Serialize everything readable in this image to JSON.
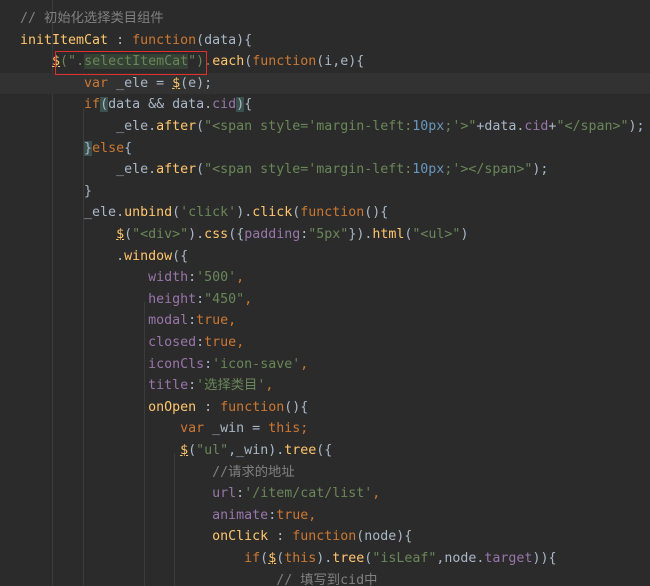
{
  "editor": {
    "language": "javascript",
    "lines": [
      {
        "segments": [
          {
            "t": "// 初始化选择类目组件",
            "c": "c"
          }
        ]
      },
      {
        "segments": [
          {
            "t": "initItemCat",
            "c": "f"
          },
          {
            "t": " : ",
            "c": "o"
          },
          {
            "t": "function",
            "c": "k"
          },
          {
            "t": "(data){",
            "c": "o"
          }
        ]
      },
      {
        "segments": [
          {
            "t": "    ",
            "c": "t"
          },
          {
            "t": "$",
            "c": "f",
            "u": true
          },
          {
            "t": "(\"",
            "c": "s"
          },
          {
            "t": ".",
            "c": "s"
          },
          {
            "t": "selectItemCat",
            "c": "s",
            "hl": "w"
          },
          {
            "t": "\").",
            "c": "s"
          },
          {
            "t": "each",
            "c": "f"
          },
          {
            "t": "(",
            "c": "o"
          },
          {
            "t": "function",
            "c": "k"
          },
          {
            "t": "(i,e){",
            "c": "o"
          }
        ]
      },
      {
        "segments": [
          {
            "t": "        ",
            "c": "t"
          },
          {
            "t": "var",
            "c": "k"
          },
          {
            "t": " _ele = ",
            "c": "t"
          },
          {
            "t": "$",
            "c": "f",
            "u": true
          },
          {
            "t": "(e);",
            "c": "o"
          }
        ]
      },
      {
        "segments": [
          {
            "t": "        ",
            "c": "t"
          },
          {
            "t": "if",
            "c": "k"
          },
          {
            "t": "(",
            "c": "o",
            "hl": "b"
          },
          {
            "t": "data && data.",
            "c": "t"
          },
          {
            "t": "cid",
            "c": "p"
          },
          {
            "t": ")",
            "c": "o",
            "hl": "b"
          },
          {
            "t": "{",
            "c": "o"
          }
        ]
      },
      {
        "segments": [
          {
            "t": "            _ele.",
            "c": "t"
          },
          {
            "t": "after",
            "c": "f"
          },
          {
            "t": "(",
            "c": "o"
          },
          {
            "t": "\"<span style='margin-left:",
            "c": "s"
          },
          {
            "t": "10px",
            "c": "n"
          },
          {
            "t": ";'>\"",
            "c": "s"
          },
          {
            "t": "+data.",
            "c": "t"
          },
          {
            "t": "cid",
            "c": "p"
          },
          {
            "t": "+",
            "c": "o"
          },
          {
            "t": "\"</span>\"",
            "c": "s"
          },
          {
            "t": ");",
            "c": "o"
          }
        ]
      },
      {
        "segments": [
          {
            "t": "        ",
            "c": "t"
          },
          {
            "t": "}",
            "c": "o",
            "hl": "b"
          },
          {
            "t": "else",
            "c": "k"
          },
          {
            "t": "{",
            "c": "o"
          }
        ]
      },
      {
        "segments": [
          {
            "t": "            _ele.",
            "c": "t"
          },
          {
            "t": "after",
            "c": "f"
          },
          {
            "t": "(",
            "c": "o"
          },
          {
            "t": "\"<span style='margin-left:",
            "c": "s"
          },
          {
            "t": "10px",
            "c": "n"
          },
          {
            "t": ";'></span>\"",
            "c": "s"
          },
          {
            "t": ");",
            "c": "o"
          }
        ]
      },
      {
        "segments": [
          {
            "t": "        }",
            "c": "o"
          }
        ]
      },
      {
        "segments": [
          {
            "t": "        _ele.",
            "c": "t"
          },
          {
            "t": "unbind",
            "c": "f"
          },
          {
            "t": "(",
            "c": "o"
          },
          {
            "t": "'click'",
            "c": "s"
          },
          {
            "t": ").",
            "c": "o"
          },
          {
            "t": "click",
            "c": "f"
          },
          {
            "t": "(",
            "c": "o"
          },
          {
            "t": "function",
            "c": "k"
          },
          {
            "t": "(){",
            "c": "o"
          }
        ]
      },
      {
        "segments": [
          {
            "t": "            ",
            "c": "t"
          },
          {
            "t": "$",
            "c": "f",
            "u": true
          },
          {
            "t": "(",
            "c": "o"
          },
          {
            "t": "\"<div>\"",
            "c": "s"
          },
          {
            "t": ").",
            "c": "o"
          },
          {
            "t": "css",
            "c": "f"
          },
          {
            "t": "({",
            "c": "o"
          },
          {
            "t": "padding",
            "c": "p"
          },
          {
            "t": ":",
            "c": "o"
          },
          {
            "t": "\"5px\"",
            "c": "s"
          },
          {
            "t": "}).",
            "c": "o"
          },
          {
            "t": "html",
            "c": "f"
          },
          {
            "t": "(",
            "c": "o"
          },
          {
            "t": "\"<ul>\"",
            "c": "s"
          },
          {
            "t": ")",
            "c": "o"
          }
        ]
      },
      {
        "segments": [
          {
            "t": "            .",
            "c": "o"
          },
          {
            "t": "window",
            "c": "f"
          },
          {
            "t": "({",
            "c": "o"
          }
        ]
      },
      {
        "segments": [
          {
            "t": "                ",
            "c": "t"
          },
          {
            "t": "width",
            "c": "p"
          },
          {
            "t": ":",
            "c": "o"
          },
          {
            "t": "'500'",
            "c": "s"
          },
          {
            "t": ",",
            "c": "k"
          }
        ]
      },
      {
        "segments": [
          {
            "t": "                ",
            "c": "t"
          },
          {
            "t": "height",
            "c": "p"
          },
          {
            "t": ":",
            "c": "o"
          },
          {
            "t": "\"450\"",
            "c": "s"
          },
          {
            "t": ",",
            "c": "k"
          }
        ]
      },
      {
        "segments": [
          {
            "t": "                ",
            "c": "t"
          },
          {
            "t": "modal",
            "c": "p"
          },
          {
            "t": ":",
            "c": "o"
          },
          {
            "t": "true",
            "c": "k"
          },
          {
            "t": ",",
            "c": "k"
          }
        ]
      },
      {
        "segments": [
          {
            "t": "                ",
            "c": "t"
          },
          {
            "t": "closed",
            "c": "p"
          },
          {
            "t": ":",
            "c": "o"
          },
          {
            "t": "true",
            "c": "k"
          },
          {
            "t": ",",
            "c": "k"
          }
        ]
      },
      {
        "segments": [
          {
            "t": "                ",
            "c": "t"
          },
          {
            "t": "iconCls",
            "c": "p"
          },
          {
            "t": ":",
            "c": "o"
          },
          {
            "t": "'icon-save'",
            "c": "s"
          },
          {
            "t": ",",
            "c": "k"
          }
        ]
      },
      {
        "segments": [
          {
            "t": "                ",
            "c": "t"
          },
          {
            "t": "title",
            "c": "p"
          },
          {
            "t": ":",
            "c": "o"
          },
          {
            "t": "'选择类目'",
            "c": "s"
          },
          {
            "t": ",",
            "c": "k"
          }
        ]
      },
      {
        "segments": [
          {
            "t": "                ",
            "c": "t"
          },
          {
            "t": "onOpen",
            "c": "f"
          },
          {
            "t": " : ",
            "c": "o"
          },
          {
            "t": "function",
            "c": "k"
          },
          {
            "t": "(){",
            "c": "o"
          }
        ]
      },
      {
        "segments": [
          {
            "t": "                    ",
            "c": "t"
          },
          {
            "t": "var",
            "c": "k"
          },
          {
            "t": " _win = ",
            "c": "t"
          },
          {
            "t": "this",
            "c": "k"
          },
          {
            "t": ";",
            "c": "k"
          }
        ]
      },
      {
        "segments": [
          {
            "t": "                    ",
            "c": "t"
          },
          {
            "t": "$",
            "c": "f",
            "u": true
          },
          {
            "t": "(",
            "c": "o"
          },
          {
            "t": "\"ul\"",
            "c": "s"
          },
          {
            "t": ",_win).",
            "c": "o"
          },
          {
            "t": "tree",
            "c": "f"
          },
          {
            "t": "({",
            "c": "o"
          }
        ]
      },
      {
        "segments": [
          {
            "t": "                        ",
            "c": "t"
          },
          {
            "t": "//请求的地址",
            "c": "c"
          }
        ]
      },
      {
        "segments": [
          {
            "t": "                        ",
            "c": "t"
          },
          {
            "t": "url",
            "c": "p"
          },
          {
            "t": ":",
            "c": "o"
          },
          {
            "t": "'/item/cat/list'",
            "c": "s"
          },
          {
            "t": ",",
            "c": "k"
          }
        ]
      },
      {
        "segments": [
          {
            "t": "                        ",
            "c": "t"
          },
          {
            "t": "animate",
            "c": "p"
          },
          {
            "t": ":",
            "c": "o"
          },
          {
            "t": "true",
            "c": "k"
          },
          {
            "t": ",",
            "c": "k"
          }
        ]
      },
      {
        "segments": [
          {
            "t": "                        ",
            "c": "t"
          },
          {
            "t": "onClick",
            "c": "f"
          },
          {
            "t": " : ",
            "c": "o"
          },
          {
            "t": "function",
            "c": "k"
          },
          {
            "t": "(node){",
            "c": "o"
          }
        ]
      },
      {
        "segments": [
          {
            "t": "                            ",
            "c": "t"
          },
          {
            "t": "if",
            "c": "k"
          },
          {
            "t": "(",
            "c": "o"
          },
          {
            "t": "$",
            "c": "f",
            "u": true
          },
          {
            "t": "(",
            "c": "o"
          },
          {
            "t": "this",
            "c": "k"
          },
          {
            "t": ").",
            "c": "o"
          },
          {
            "t": "tree",
            "c": "f"
          },
          {
            "t": "(",
            "c": "o"
          },
          {
            "t": "\"isLeaf\"",
            "c": "s"
          },
          {
            "t": ",node.",
            "c": "o"
          },
          {
            "t": "target",
            "c": "p"
          },
          {
            "t": ")){",
            "c": "o"
          }
        ]
      },
      {
        "segments": [
          {
            "t": "                                ",
            "c": "t"
          },
          {
            "t": "// 填写到cid中",
            "c": "c"
          }
        ]
      }
    ]
  }
}
